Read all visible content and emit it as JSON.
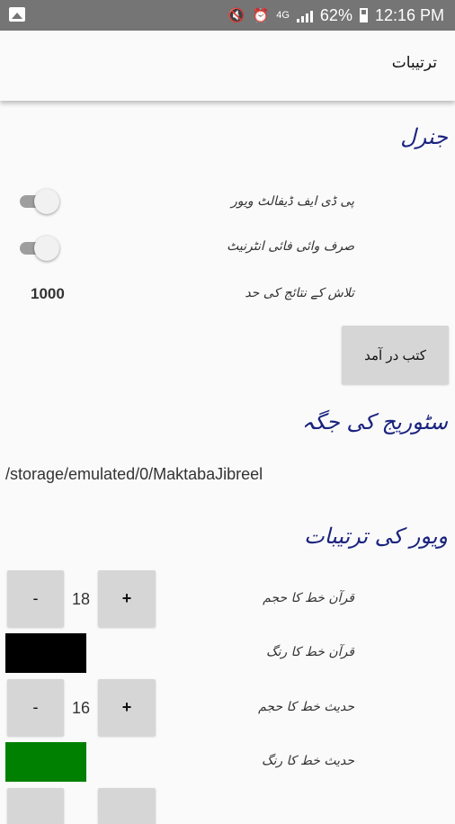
{
  "status_bar": {
    "network": "4G",
    "battery": "62%",
    "time": "12:16 PM"
  },
  "app_bar": {
    "title": "ترتیبات"
  },
  "general": {
    "title": "جنرل",
    "pdf_default_viewer_label": "پی ڈی ایف ڈیفالٹ ویور",
    "pdf_default_viewer_on": false,
    "wifi_only_label": "صرف وائی فائی انٹرنیٹ",
    "wifi_only_on": false,
    "search_limit_label": "تلاش کے نتائج کی حد",
    "search_limit_value": "1000",
    "import_books_button": "کتب در آمد"
  },
  "storage": {
    "title": "سٹوریج کی جگہ",
    "path": "/storage/emulated/0/MaktabaJibreel"
  },
  "viewer": {
    "title": "ویور کی ترتیبات",
    "quran_font_size_label": "قرآن خط کا حجم",
    "quran_font_size_value": "18",
    "quran_font_color_label": "قرآن خط کا رنگ",
    "quran_font_color": "#000000",
    "hadith_font_size_label": "حدیث خط کا حجم",
    "hadith_font_size_value": "16",
    "hadith_font_color_label": "حدیث خط کا رنگ",
    "hadith_font_color": "#008000",
    "minus_label": "-",
    "plus_label": "+"
  }
}
